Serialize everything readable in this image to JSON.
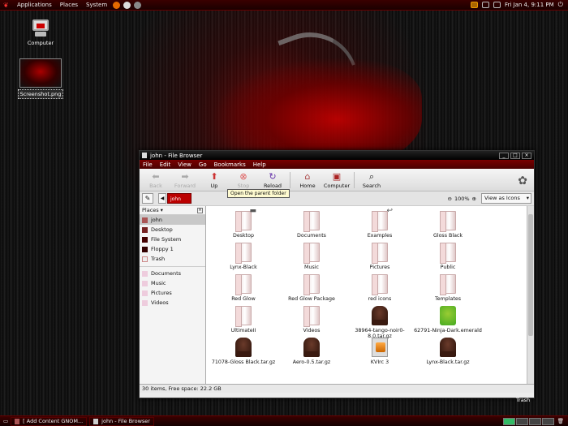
{
  "top_panel": {
    "menus": [
      "Applications",
      "Places",
      "System"
    ],
    "clock": "Fri Jan  4,  9:11 PM"
  },
  "desktop": {
    "icons": [
      {
        "label": "Computer"
      },
      {
        "label": "Screenshot.png"
      }
    ],
    "trash_label": "Trash"
  },
  "window": {
    "title": "john - File Browser",
    "menubar": [
      "File",
      "Edit",
      "View",
      "Go",
      "Bookmarks",
      "Help"
    ],
    "toolbar": {
      "back": "Back",
      "forward": "Forward",
      "up": "Up",
      "stop": "Stop",
      "reload": "Reload",
      "home": "Home",
      "computer": "Computer",
      "search": "Search"
    },
    "tooltip": "Open the parent folder",
    "location": {
      "crumb": "john",
      "zoom": "100%",
      "view_mode": "View as Icons"
    },
    "sidebar": {
      "title": "Places",
      "items": [
        "john",
        "Desktop",
        "File System",
        "Floppy 1",
        "Trash"
      ],
      "bookmarks": [
        "Documents",
        "Music",
        "Pictures",
        "Videos"
      ]
    },
    "files": [
      {
        "name": "Desktop",
        "kind": "folder"
      },
      {
        "name": "Documents",
        "kind": "folder"
      },
      {
        "name": "Examples",
        "kind": "folder"
      },
      {
        "name": "Gloss Black",
        "kind": "folder"
      },
      {
        "name": "Lynx-Black",
        "kind": "folder"
      },
      {
        "name": "Music",
        "kind": "folder"
      },
      {
        "name": "Pictures",
        "kind": "folder"
      },
      {
        "name": "Public",
        "kind": "folder"
      },
      {
        "name": "Red Glow",
        "kind": "folder"
      },
      {
        "name": "Red Glow Package",
        "kind": "folder"
      },
      {
        "name": "red icons",
        "kind": "folder"
      },
      {
        "name": "Templates",
        "kind": "folder"
      },
      {
        "name": "UltimateII",
        "kind": "folder"
      },
      {
        "name": "Videos",
        "kind": "folder"
      },
      {
        "name": "38964-tango-noir0-8.0.tar.gz",
        "kind": "archive"
      },
      {
        "name": "62791-Ninja-Dark.emerald",
        "kind": "emerald"
      },
      {
        "name": "71078-Gloss Black.tar.gz",
        "kind": "archive"
      },
      {
        "name": "Aero-0.5.tar.gz",
        "kind": "archive"
      },
      {
        "name": "KVIrc 3",
        "kind": "kvirc"
      },
      {
        "name": "Lynx-Black.tar.gz",
        "kind": "archive"
      }
    ],
    "status": "30 items, Free space: 22.2 GB"
  },
  "bottom_panel": {
    "tasks": [
      "[ Add Content GNOM...",
      "john - File Browser"
    ]
  }
}
